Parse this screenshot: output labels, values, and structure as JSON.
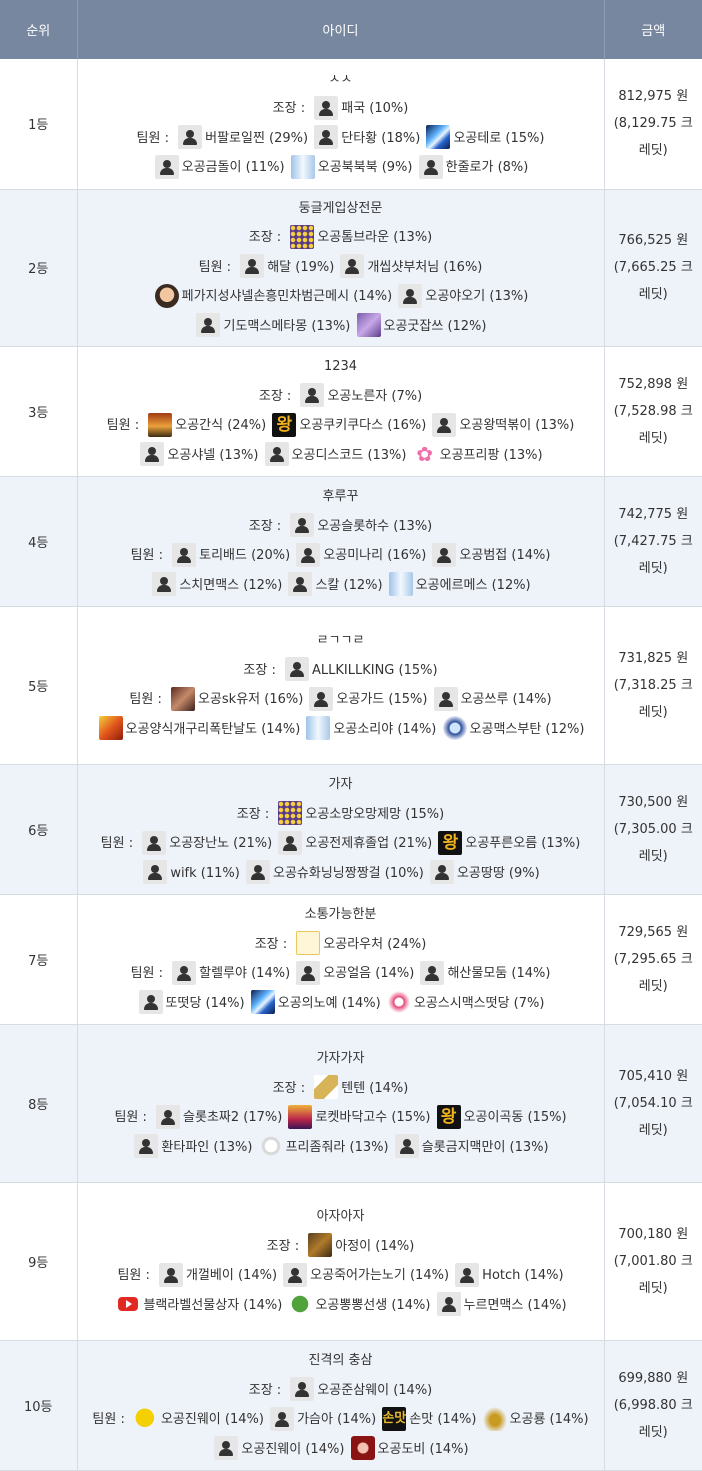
{
  "header": {
    "rank": "순위",
    "id": "아이디",
    "amount": "금액"
  },
  "labels": {
    "leader": "조장 : ",
    "members": "팀원 : "
  },
  "rows": [
    {
      "rank": "1등",
      "guild": "ㅅㅅ",
      "leader": {
        "icon": "default",
        "text": "패국 (10%)"
      },
      "members": [
        {
          "icon": "default",
          "text": "버팔로일찐 (29%)"
        },
        {
          "icon": "default",
          "text": "단타황 (18%)"
        },
        {
          "icon": "blue",
          "text": "오공테로 (15%)"
        },
        {
          "icon": "default",
          "text": "오공금돌이 (11%)"
        },
        {
          "icon": "ice",
          "text": "오공북북북 (9%)"
        },
        {
          "icon": "default",
          "text": "한줄로가 (8%)"
        }
      ],
      "amount": "812,975 원",
      "credit": "(8,129.75 크레딧)"
    },
    {
      "rank": "2등",
      "guild": "둥글게입상전문",
      "leader": {
        "icon": "grid",
        "text": "오공톰브라운 (13%)"
      },
      "members": [
        {
          "icon": "default",
          "text": "해달 (19%)"
        },
        {
          "icon": "default",
          "text": "개씹샷부처님 (16%)"
        },
        {
          "icon": "face",
          "text": "페가지성샤넬손흥민차범근메시 (14%)"
        },
        {
          "icon": "default",
          "text": "오공야오기 (13%)"
        },
        {
          "icon": "default",
          "text": "기도맥스메타몽 (13%)"
        },
        {
          "icon": "purple",
          "text": "오공굿잡쓰 (12%)"
        }
      ],
      "amount": "766,525 원",
      "credit": "(7,665.25 크레딧)"
    },
    {
      "rank": "3등",
      "guild": "1234",
      "leader": {
        "icon": "default",
        "text": "오공노른자 (7%)"
      },
      "members": [
        {
          "icon": "chest",
          "text": "오공간식 (24%)"
        },
        {
          "icon": "wang",
          "text": "오공쿠키쿠다스 (16%)"
        },
        {
          "icon": "default",
          "text": "오공왕떡볶이 (13%)"
        },
        {
          "icon": "default",
          "text": "오공샤넬 (13%)"
        },
        {
          "icon": "default",
          "text": "오공디스코드 (13%)"
        },
        {
          "icon": "sakura",
          "text": "오공프리팡 (13%)"
        }
      ],
      "amount": "752,898 원",
      "credit": "(7,528.98 크레딧)"
    },
    {
      "rank": "4등",
      "guild": "후루꾸",
      "leader": {
        "icon": "default",
        "text": "오공슬롯하수 (13%)"
      },
      "members": [
        {
          "icon": "default",
          "text": "토리배드 (20%)"
        },
        {
          "icon": "default",
          "text": "오공미나리 (16%)"
        },
        {
          "icon": "default",
          "text": "오공범접 (14%)"
        },
        {
          "icon": "default",
          "text": "스치면맥스 (12%)"
        },
        {
          "icon": "default",
          "text": "스칼 (12%)"
        },
        {
          "icon": "ice",
          "text": "오공에르메스 (12%)"
        }
      ],
      "amount": "742,775 원",
      "credit": "(7,427.75 크레딧)"
    },
    {
      "rank": "5등",
      "guild": "ㄹㄱㄱㄹ",
      "leader": {
        "icon": "default",
        "text": "ALLKILLKING (15%)"
      },
      "members": [
        {
          "icon": "dark",
          "text": "오공sk유저 (16%)"
        },
        {
          "icon": "default",
          "text": "오공가드 (15%)"
        },
        {
          "icon": "default",
          "text": "오공쓰루 (14%)"
        },
        {
          "icon": "fire",
          "text": "오공양식개구리폭탄날도 (14%)"
        },
        {
          "icon": "ice",
          "text": "오공소리야 (14%)"
        },
        {
          "icon": "shield",
          "text": "오공맥스부탄 (12%)"
        }
      ],
      "amount": "731,825 원",
      "credit": "(7,318.25 크레딧)"
    },
    {
      "rank": "6등",
      "guild": "가자",
      "leader": {
        "icon": "grid",
        "text": "오공소망오망제망 (15%)"
      },
      "members": [
        {
          "icon": "default",
          "text": "오공장난노 (21%)"
        },
        {
          "icon": "default",
          "text": "오공전제휴졸업 (21%)"
        },
        {
          "icon": "wang",
          "text": "오공푸른오름 (13%)"
        },
        {
          "icon": "default",
          "text": "wifk (11%)"
        },
        {
          "icon": "default",
          "text": "오공슈화닝닝짱짱걸 (10%)"
        },
        {
          "icon": "default",
          "text": "오공땅땅 (9%)"
        }
      ],
      "amount": "730,500 원",
      "credit": "(7,305.00 크레딧)"
    },
    {
      "rank": "7등",
      "guild": "소통가능한분",
      "leader": {
        "icon": "cat",
        "text": "오공라우처 (24%)"
      },
      "members": [
        {
          "icon": "default",
          "text": "할렐루야 (14%)"
        },
        {
          "icon": "default",
          "text": "오공얼음 (14%)"
        },
        {
          "icon": "default",
          "text": "해산물모둠 (14%)"
        },
        {
          "icon": "default",
          "text": "또떳당 (14%)"
        },
        {
          "icon": "blue",
          "text": "오공의노예 (14%)"
        },
        {
          "icon": "pinky",
          "text": "오공스시맥스떳당 (7%)"
        }
      ],
      "amount": "729,565 원",
      "credit": "(7,295.65 크레딧)"
    },
    {
      "rank": "8등",
      "guild": "가자가자",
      "leader": {
        "icon": "baton",
        "text": "텐텐 (14%)"
      },
      "members": [
        {
          "icon": "default",
          "text": "슬롯초짜2 (17%)"
        },
        {
          "icon": "rocket",
          "text": "로켓바닥고수 (15%)"
        },
        {
          "icon": "wang",
          "text": "오공이곡동 (15%)"
        },
        {
          "icon": "default",
          "text": "환타파인 (13%)"
        },
        {
          "icon": "skel",
          "text": "프리좀줘라 (13%)"
        },
        {
          "icon": "default",
          "text": "슬롯금지맥만이 (13%)"
        }
      ],
      "amount": "705,410 원",
      "credit": "(7,054.10 크레딧)"
    },
    {
      "rank": "9등",
      "guild": "아자아자",
      "leader": {
        "icon": "mine",
        "text": "아정이 (14%)"
      },
      "members": [
        {
          "icon": "default",
          "text": "개껄베이 (14%)"
        },
        {
          "icon": "default",
          "text": "오공죽어가는노기 (14%)"
        },
        {
          "icon": "default",
          "text": "Hotch (14%)"
        },
        {
          "icon": "play",
          "text": "블랙라벨선물상자 (14%)"
        },
        {
          "icon": "goblin",
          "text": "오공뽕뽕선생 (14%)"
        },
        {
          "icon": "default",
          "text": "누르면맥스 (14%)"
        }
      ],
      "amount": "700,180 원",
      "credit": "(7,001.80 크레딧)"
    },
    {
      "rank": "10등",
      "guild": "진격의 충삼",
      "leader": {
        "icon": "default",
        "text": "오공준삼웨이 (14%)"
      },
      "members": [
        {
          "icon": "duck",
          "text": "오공진웨이 (14%)"
        },
        {
          "icon": "default",
          "text": "가슴아 (14%)"
        },
        {
          "icon": "seo",
          "text": "손맛 (14%)"
        },
        {
          "icon": "lion",
          "text": "오공룡 (14%)"
        },
        {
          "icon": "default",
          "text": "오공진웨이 (14%)"
        },
        {
          "icon": "oc",
          "text": "오공도비 (14%)"
        }
      ],
      "amount": "699,880 원",
      "credit": "(6,998.80 크레딧)"
    }
  ]
}
